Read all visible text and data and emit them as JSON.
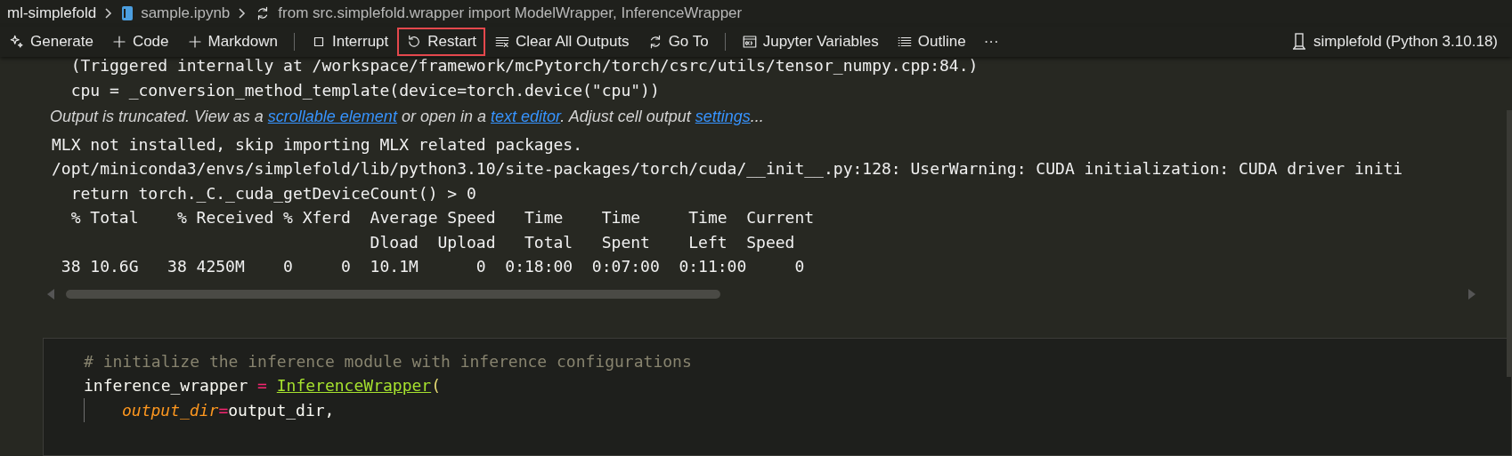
{
  "breadcrumb": [
    {
      "label": "ml-simplefold",
      "kind": "folder"
    },
    {
      "label": "sample.ipynb",
      "kind": "notebook"
    },
    {
      "label": "from src.simplefold.wrapper import ModelWrapper, InferenceWrapper",
      "kind": "cell"
    }
  ],
  "toolbar": {
    "items": [
      {
        "label": "Generate",
        "highlighted": false
      },
      {
        "label": "Code",
        "highlighted": false
      },
      {
        "label": "Markdown",
        "highlighted": false
      },
      {
        "kind": "separator"
      },
      {
        "label": "Interrupt",
        "highlighted": false
      },
      {
        "label": "Restart",
        "highlighted": true
      },
      {
        "label": "Clear All Outputs",
        "highlighted": false
      },
      {
        "label": "Go To",
        "highlighted": false
      },
      {
        "kind": "separator"
      },
      {
        "label": "Jupyter Variables",
        "highlighted": false
      },
      {
        "label": "Outline",
        "highlighted": false
      },
      {
        "label": "···",
        "highlighted": false
      }
    ],
    "kernel": "simplefold (Python 3.10.18)"
  },
  "output": {
    "pre_lines": [
      "  (Triggered internally at /workspace/framework/mcPytorch/torch/csrc/utils/tensor_numpy.cpp:84.)",
      "  cpu = _conversion_method_template(device=torch.device(\"cpu\"))"
    ],
    "notice": [
      {
        "kind": "text",
        "text": "Output is truncated. View as a "
      },
      {
        "kind": "link",
        "text": "scrollable element"
      },
      {
        "kind": "text",
        "text": " or open in a "
      },
      {
        "kind": "link",
        "text": "text editor"
      },
      {
        "kind": "text",
        "text": ". Adjust cell output "
      },
      {
        "kind": "link",
        "text": "settings"
      },
      {
        "kind": "text",
        "text": "..."
      }
    ],
    "lines": [
      "MLX not installed, skip importing MLX related packages.",
      "/opt/miniconda3/envs/simplefold/lib/python3.10/site-packages/torch/cuda/__init__.py:128: UserWarning: CUDA initialization: CUDA driver initi",
      "  return torch._C._cuda_getDeviceCount() > 0",
      "  % Total    % Received % Xferd  Average Speed   Time    Time     Time  Current",
      "                                 Dload  Upload   Total   Spent    Left  Speed",
      " 38 10.6G   38 4250M    0     0  10.1M      0  0:18:00  0:07:00  0:11:00     0"
    ]
  },
  "code_cell": {
    "lines": [
      {
        "indented": false,
        "tokens": [
          {
            "kind": "comment",
            "text": "# initialize the inference module with inference configurations"
          }
        ]
      },
      {
        "indented": false,
        "tokens": [
          {
            "kind": "plain",
            "text": "inference_wrapper "
          },
          {
            "kind": "operator",
            "text": "= "
          },
          {
            "kind": "class",
            "text": "InferenceWrapper"
          },
          {
            "kind": "paren",
            "text": "("
          }
        ]
      },
      {
        "indented": true,
        "tokens": [
          {
            "kind": "param",
            "text": "output_dir"
          },
          {
            "kind": "operator",
            "text": "="
          },
          {
            "kind": "plain",
            "text": "output_dir,"
          }
        ]
      }
    ]
  }
}
